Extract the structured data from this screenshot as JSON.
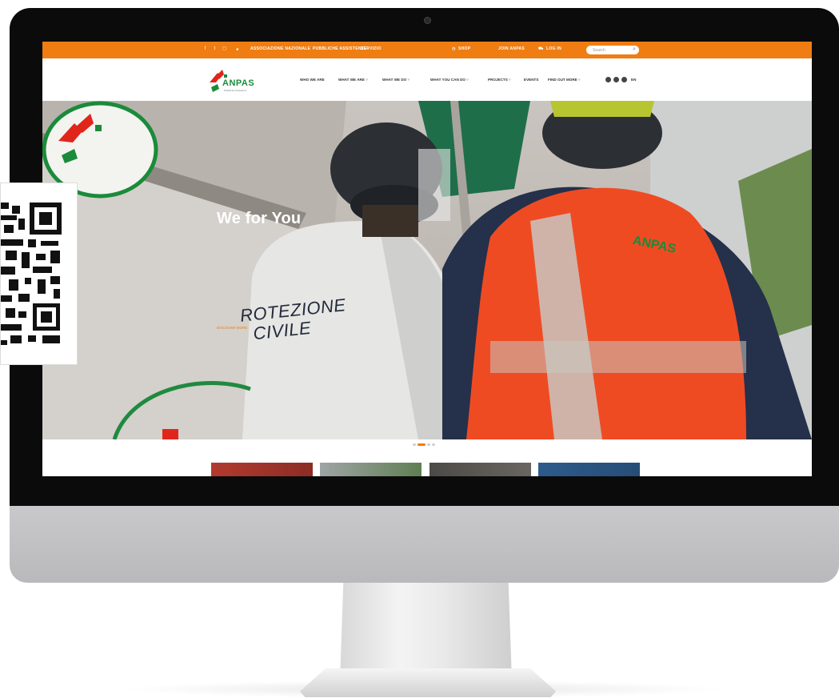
{
  "topbar": {
    "links": [
      "ASSOCIAZIONE NAZIONALE",
      "PUBBLICHE ASSISTENZE",
      "SERVIZIO"
    ],
    "account": {
      "shop_label": "SHOP",
      "join_label": "JOIN ANPAS",
      "login_label": "LOG IN"
    },
    "search_placeholder": "Search"
  },
  "navbar": {
    "logo_text": "ANPAS",
    "logo_subtitle": "Pubbliche Assistenze",
    "items": [
      {
        "label": "WHO WE ARE"
      },
      {
        "label": "WHAT WE ARE"
      },
      {
        "label": "WHAT WE DO"
      },
      {
        "label": "WHAT YOU CAN DO"
      },
      {
        "label": "PROJECTS"
      },
      {
        "label": "EVENTS"
      },
      {
        "label": "FIND OUT MORE"
      }
    ],
    "language": "EN"
  },
  "hero": {
    "title": "We for You",
    "cta": "DISCOVER MORE",
    "shirt_text_line1": "ROTEZIONE",
    "shirt_text_line2": "CIVILE",
    "badge_text": "ANPAS"
  },
  "colors": {
    "accent": "#ef7d11",
    "brand_green": "#1a8b3a",
    "brand_red": "#e0261b"
  }
}
